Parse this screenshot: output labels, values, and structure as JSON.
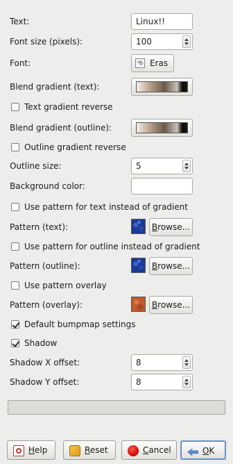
{
  "fields": {
    "text": {
      "label": "Text:",
      "value": "Linux!!"
    },
    "font_size": {
      "label": "Font size (pixels):",
      "value": "100"
    },
    "font": {
      "label": "Font:",
      "icon_glyph": "ᵃb",
      "value": "Eras"
    },
    "blend_text": {
      "label": "Blend gradient (text):"
    },
    "text_grad_reverse": {
      "label": "Text gradient reverse",
      "checked": false
    },
    "blend_outline": {
      "label": "Blend gradient (outline):"
    },
    "outline_grad_reverse": {
      "label": "Outline gradient reverse",
      "checked": false
    },
    "outline_size": {
      "label": "Outline size:",
      "value": "5"
    },
    "bg_color": {
      "label": "Background color:",
      "color": "#ffffff"
    },
    "use_pattern_text": {
      "label": "Use pattern for text instead of gradient",
      "checked": false
    },
    "pattern_text": {
      "label": "Pattern (text):",
      "button": "Browse..."
    },
    "use_pattern_outline": {
      "label": "Use pattern for outline instead of gradient",
      "checked": false
    },
    "pattern_outline": {
      "label": "Pattern (outline):",
      "button": "Browse..."
    },
    "use_pattern_overlay": {
      "label": "Use pattern overlay",
      "checked": false
    },
    "pattern_overlay": {
      "label": "Pattern (overlay):",
      "button": "Browse..."
    },
    "default_bumpmap": {
      "label": "Default bumpmap settings",
      "checked": true
    },
    "shadow": {
      "label": "Shadow",
      "checked": true
    },
    "shadow_x": {
      "label": "Shadow X offset:",
      "value": "8"
    },
    "shadow_y": {
      "label": "Shadow Y offset:",
      "value": "8"
    }
  },
  "progress": {
    "fraction": 0
  },
  "buttons": {
    "help": "Help",
    "reset": "Reset",
    "cancel": "Cancel",
    "ok": "OK"
  },
  "colors": {
    "background": "#ededeb",
    "default_button_border": "#6d8fc2",
    "pattern_text_color": "#1b3a93",
    "pattern_overlay_color": "#c25a2a"
  },
  "icons": {
    "help": "help-icon",
    "reset": "reset-icon",
    "cancel": "cancel-icon",
    "ok": "ok-icon",
    "font": "font-icon"
  }
}
